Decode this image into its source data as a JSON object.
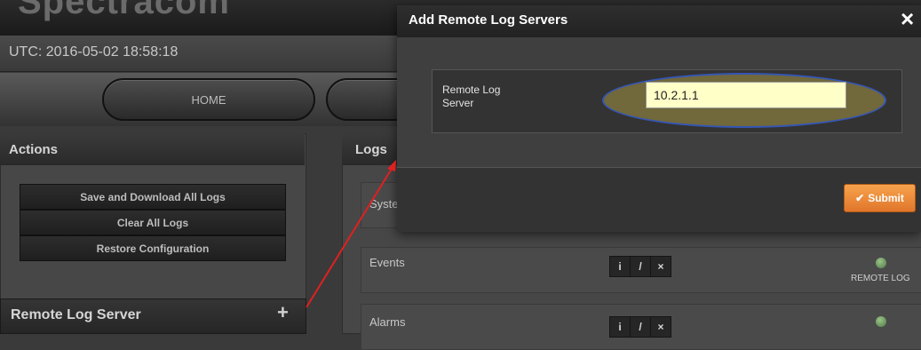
{
  "header": {
    "logo_text": "Spectracom",
    "utc_label": "UTC: 2016-05-02 18:58:18"
  },
  "nav": {
    "home_label": "HOME"
  },
  "actions": {
    "title": "Actions",
    "buttons": [
      "Save and Download All Logs",
      "Clear All Logs",
      "Restore Configuration"
    ]
  },
  "remote_log_server": {
    "title": "Remote Log Server",
    "add_icon": "plus-icon",
    "add_glyph": "+"
  },
  "logs": {
    "title": "Logs",
    "rows": [
      {
        "label": "System"
      },
      {
        "label": "Events"
      },
      {
        "label": "Alarms"
      }
    ],
    "remote_log_label": "REMOTE LOG",
    "icons": {
      "info": "i",
      "edit": "/",
      "delete": "×"
    }
  },
  "modal": {
    "title": "Add Remote Log Servers",
    "close_glyph": "×",
    "field_label": "Remote Log Server",
    "field_value": "10.2.1.1",
    "submit_label": "Submit",
    "submit_glyph": "✔"
  },
  "colors": {
    "accent": "#f0913b",
    "highlight": "#7a6e3c",
    "arrow": "#e02020"
  }
}
